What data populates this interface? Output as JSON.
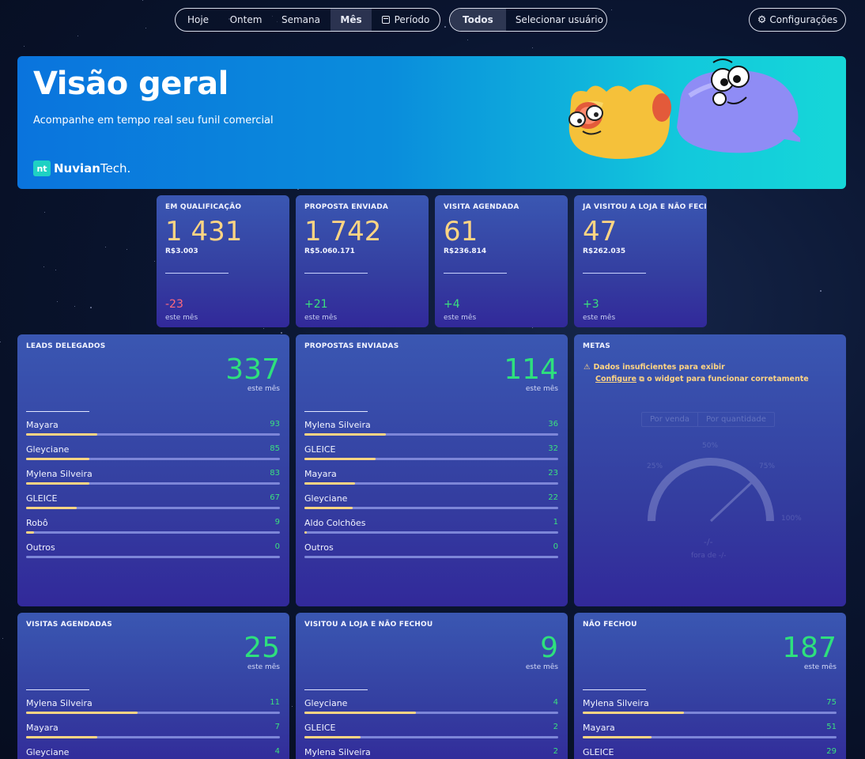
{
  "toolbar": {
    "period_options": [
      {
        "label": "Hoje",
        "active": false
      },
      {
        "label": "Ontem",
        "active": false
      },
      {
        "label": "Semana",
        "active": false
      },
      {
        "label": "Mês",
        "active": true
      },
      {
        "label": "Período",
        "active": false
      }
    ],
    "user_filter": {
      "all_label": "Todos",
      "select_label": "Selecionar usuário"
    },
    "settings_label": "Configurações"
  },
  "hero": {
    "title": "Visão geral",
    "subtitle": "Acompanhe em tempo real seu funil comercial",
    "brand_mark": "nt",
    "brand_name_bold": "Nuvian",
    "brand_name_light": "Tech."
  },
  "stats": [
    {
      "title": "EM QUALIFICAÇÃO",
      "value": "1 431",
      "money": "R$3.003",
      "delta": "-23",
      "caption": "este mês"
    },
    {
      "title": "PROPOSTA ENVIADA",
      "value": "1 742",
      "money": "R$5.060.171",
      "delta": "+21",
      "caption": "este mês"
    },
    {
      "title": "VISITA AGENDADA",
      "value": "61",
      "money": "R$236.814",
      "delta": "+4",
      "caption": "este mês"
    },
    {
      "title": "JA VISITOU A LOJA E NÃO FECI",
      "value": "47",
      "money": "R$262.035",
      "delta": "+3",
      "caption": "este mês"
    }
  ],
  "lists": [
    {
      "title": "LEADS DELEGADOS",
      "total": "337",
      "caption": "este mês",
      "rows": [
        {
          "name": "Mayara",
          "value": "93",
          "fill": 0.28
        },
        {
          "name": "Gleyciane",
          "value": "85",
          "fill": 0.25
        },
        {
          "name": "Mylena Silveira",
          "value": "83",
          "fill": 0.25
        },
        {
          "name": "GLEICE",
          "value": "67",
          "fill": 0.2
        },
        {
          "name": "Robô",
          "value": "9",
          "fill": 0.03
        },
        {
          "name": "Outros",
          "value": "0",
          "fill": 0
        }
      ]
    },
    {
      "title": "PROPOSTAS ENVIADAS",
      "total": "114",
      "caption": "este mês",
      "rows": [
        {
          "name": "Mylena Silveira",
          "value": "36",
          "fill": 0.32
        },
        {
          "name": "GLEICE",
          "value": "32",
          "fill": 0.28
        },
        {
          "name": "Mayara",
          "value": "23",
          "fill": 0.2
        },
        {
          "name": "Gleyciane",
          "value": "22",
          "fill": 0.19
        },
        {
          "name": "Aldo Colchões",
          "value": "1",
          "fill": 0.01
        },
        {
          "name": "Outros",
          "value": "0",
          "fill": 0
        }
      ]
    },
    {
      "title": "VISITAS AGENDADAS",
      "total": "25",
      "caption": "este mês",
      "rows": [
        {
          "name": "Mylena Silveira",
          "value": "11",
          "fill": 0.44
        },
        {
          "name": "Mayara",
          "value": "7",
          "fill": 0.28
        },
        {
          "name": "Gleyciane",
          "value": "4",
          "fill": 0.16
        }
      ]
    },
    {
      "title": "VISITOU A LOJA E NÃO FECHOU",
      "total": "9",
      "caption": "este mês",
      "rows": [
        {
          "name": "Gleyciane",
          "value": "4",
          "fill": 0.44
        },
        {
          "name": "GLEICE",
          "value": "2",
          "fill": 0.22
        },
        {
          "name": "Mylena Silveira",
          "value": "2",
          "fill": 0.22
        }
      ]
    },
    {
      "title": "NÃO FECHOU",
      "total": "187",
      "caption": "este mês",
      "rows": [
        {
          "name": "Mylena Silveira",
          "value": "75",
          "fill": 0.4
        },
        {
          "name": "Mayara",
          "value": "51",
          "fill": 0.27
        },
        {
          "name": "GLEICE",
          "value": "29",
          "fill": 0.16
        }
      ]
    }
  ],
  "metas": {
    "title": "METAS",
    "warning_line1": "Dados insuficientes para exibir",
    "configure_link": "Configure",
    "warning_line2": "o widget para funcionar corretamente",
    "tab_sale": "Por venda",
    "tab_qty": "Por quantidade",
    "gauge_center": "-/-",
    "gauge_caption": "fora de -/-",
    "tick_50": "50%",
    "tick_25": "25%",
    "tick_75": "75%",
    "tick_100": "100%"
  },
  "colors": {
    "positive": "#3be07f",
    "negative": "#ff6b7e",
    "highlight": "#ffd583",
    "card_top": "#3a57b2",
    "card_bottom": "#32299a"
  },
  "icons": [
    "calendar-icon",
    "chevron-down-icon",
    "gear-icon",
    "warning-icon",
    "external-link-icon"
  ]
}
